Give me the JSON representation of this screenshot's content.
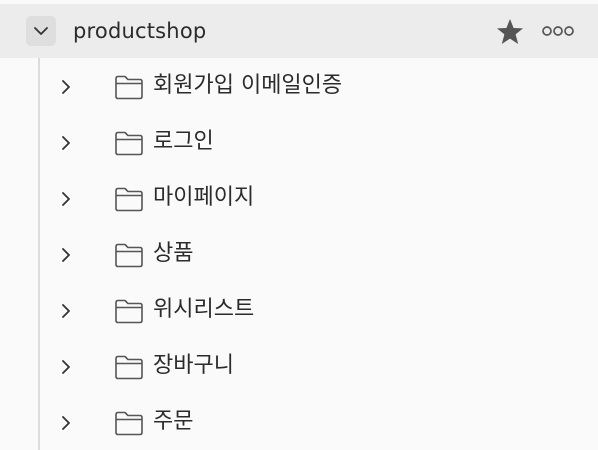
{
  "collection": {
    "name": "productshop",
    "toggle_icon": "chevron-down-icon",
    "star_icon": "star-icon",
    "more_icon": "more-options-icon"
  },
  "folders": [
    {
      "label": "회원가입 이메일인증"
    },
    {
      "label": "로그인"
    },
    {
      "label": "마이페이지"
    },
    {
      "label": "상품"
    },
    {
      "label": "위시리스트"
    },
    {
      "label": "장바구니"
    },
    {
      "label": "주문"
    }
  ],
  "colors": {
    "header_bg": "#ececec",
    "text": "#2b2b2b",
    "icon": "#555555"
  }
}
